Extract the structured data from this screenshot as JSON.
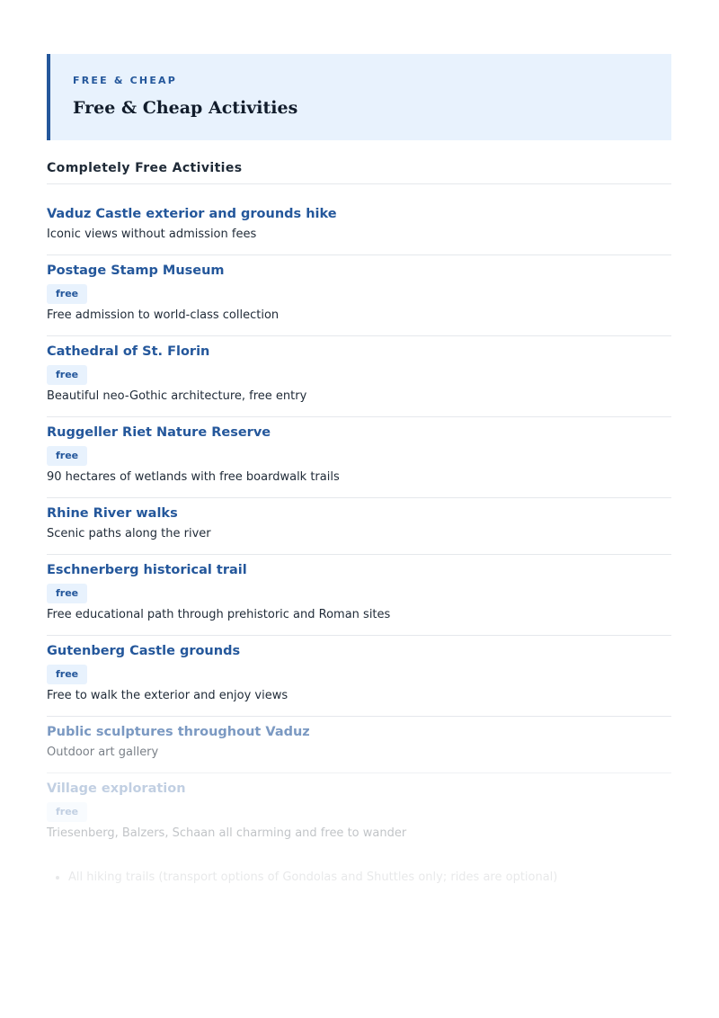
{
  "header": {
    "eyebrow": "FREE & CHEAP",
    "title": "Free & Cheap Activities"
  },
  "section": {
    "title": "Completely Free Activities"
  },
  "items": [
    {
      "name": "Vaduz Castle exterior and grounds hike",
      "badge": "",
      "desc": "Iconic views without admission fees"
    },
    {
      "name": "Postage Stamp Museum",
      "badge": "free",
      "desc": "Free admission to world-class collection"
    },
    {
      "name": "Cathedral of St. Florin",
      "badge": "free",
      "desc": "Beautiful neo-Gothic architecture, free entry"
    },
    {
      "name": "Ruggeller Riet Nature Reserve",
      "badge": "free",
      "desc": "90 hectares of wetlands with free boardwalk trails"
    },
    {
      "name": "Rhine River walks",
      "badge": "",
      "desc": "Scenic paths along the river"
    },
    {
      "name": "Eschnerberg historical trail",
      "badge": "free",
      "desc": "Free educational path through prehistoric and Roman sites"
    },
    {
      "name": "Gutenberg Castle grounds",
      "badge": "free",
      "desc": "Free to walk the exterior and enjoy views"
    },
    {
      "name": "Public sculptures throughout Vaduz",
      "badge": "",
      "desc": "Outdoor art gallery"
    },
    {
      "name": "Village exploration",
      "badge": "free",
      "desc": "Triesenberg, Balzers, Schaan all charming and free to wander"
    }
  ],
  "footer": {
    "bullet": "All hiking trails (transport options of Gondolas and Shuttles only; rides are optional)"
  },
  "colors": {
    "accent": "#24579b",
    "header_bg": "#e8f2fd"
  }
}
